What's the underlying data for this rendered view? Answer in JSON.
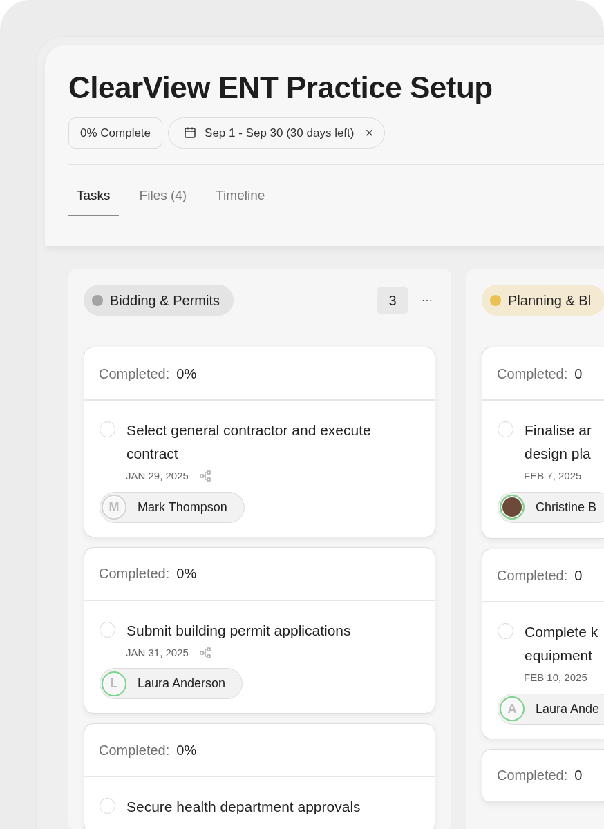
{
  "title": "ClearView ENT Practice Setup",
  "progress_chip": "0% Complete",
  "date_chip": {
    "text": "Sep 1 - Sep 30 (30 days left)",
    "close": "×"
  },
  "tabs": [
    {
      "label": "Tasks",
      "selected": true
    },
    {
      "label": "Files (4)",
      "selected": false
    },
    {
      "label": "Timeline",
      "selected": false
    }
  ],
  "columns": [
    {
      "name": "Bidding & Permits",
      "color": "#a3a3a3",
      "count": "3",
      "menu": "···",
      "cards": [
        {
          "completed_label": "Completed:",
          "completed_value": "0%",
          "title": "Select general contractor and execute contract",
          "done": false,
          "date": "JAN 29, 2025",
          "has_subtasks": true,
          "assignee": {
            "name": "Mark Thompson",
            "kind": "initial",
            "initial": "M",
            "color": "#d4d4d4"
          }
        },
        {
          "completed_label": "Completed:",
          "completed_value": "0%",
          "title": "Submit building permit applications",
          "done": false,
          "date": "JAN 31, 2025",
          "has_subtasks": true,
          "assignee": {
            "name": "Laura Anderson",
            "kind": "initial",
            "initial": "L",
            "color": "#7fd38f"
          }
        },
        {
          "completed_label": "Completed:",
          "completed_value": "0%",
          "title": "Secure health department approvals",
          "done": false
        }
      ]
    },
    {
      "name": "Planning & Bl",
      "color": "#ecc154",
      "cards": [
        {
          "completed_label": "Completed:",
          "completed_value": "0",
          "title": "Finalise ar\ndesign pla",
          "done": false,
          "date": "FEB 7, 2025",
          "assignee": {
            "name": "Christine B",
            "kind": "photo",
            "color": "#7fd38f"
          }
        },
        {
          "completed_label": "Completed:",
          "completed_value": "0",
          "title": "Complete k\nequipment",
          "done": false,
          "date": "FEB 10, 2025",
          "assignee": {
            "name": "Laura Ande",
            "kind": "initial",
            "initial": "A",
            "color": "#7fd38f"
          }
        },
        {
          "completed_label": "Completed:",
          "completed_value": "0"
        }
      ]
    }
  ]
}
